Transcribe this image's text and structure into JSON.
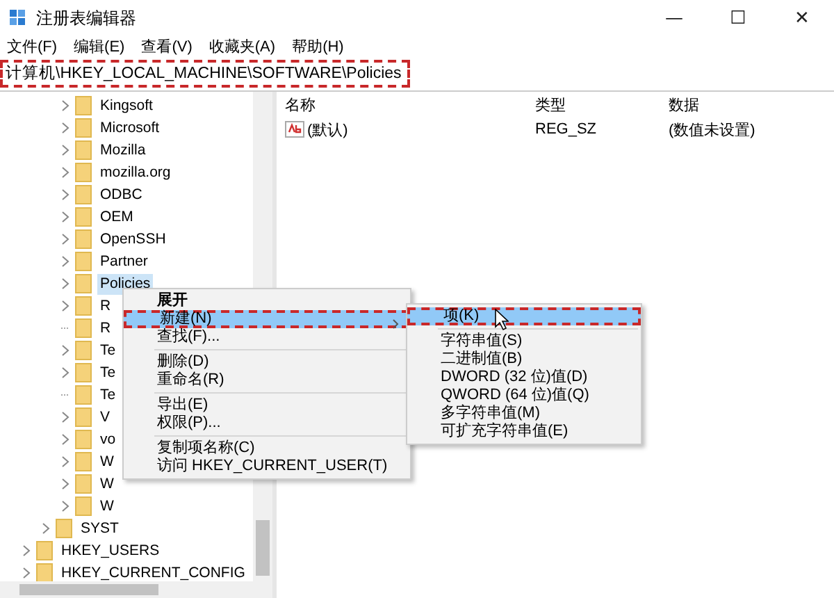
{
  "window": {
    "title": "注册表编辑器",
    "controls": [
      "—",
      "☐",
      "✕"
    ]
  },
  "menu_bar": [
    {
      "label": "文件(F)"
    },
    {
      "label": "编辑(E)"
    },
    {
      "label": "查看(V)"
    },
    {
      "label": "收藏夹(A)"
    },
    {
      "label": "帮助(H)"
    }
  ],
  "address": {
    "value": "计算机\\HKEY_LOCAL_MACHINE\\SOFTWARE\\Policies",
    "outlined": true
  },
  "tree": {
    "items": [
      {
        "children": [
          {
            "children": [
              {
                "label": "Kingsoft",
                "expandable": true,
                "selected": false
              },
              {
                "label": "Microsoft",
                "expandable": true,
                "selected": false
              },
              {
                "label": "Mozilla",
                "expandable": true,
                "selected": false
              },
              {
                "label": "mozilla.org",
                "expandable": true,
                "selected": false
              },
              {
                "label": "ODBC",
                "expandable": true,
                "selected": false
              },
              {
                "label": "OEM",
                "expandable": true,
                "selected": false
              },
              {
                "label": "OpenSSH",
                "expandable": true,
                "selected": false
              },
              {
                "label": "Partner",
                "expandable": true,
                "selected": false
              },
              {
                "label": "Policies",
                "expandable": true,
                "selected": true
              },
              {
                "label": "R",
                "expandable": true,
                "selected": false
              },
              {
                "label": "R",
                "expandable": false,
                "selected": false
              },
              {
                "label": "Te",
                "expandable": true,
                "selected": false
              },
              {
                "label": "Te",
                "expandable": true,
                "selected": false
              },
              {
                "label": "Te",
                "expandable": false,
                "selected": false
              },
              {
                "label": "V",
                "expandable": true,
                "selected": false
              },
              {
                "label": "vo",
                "expandable": true,
                "selected": false
              },
              {
                "label": "W",
                "expandable": true,
                "selected": false
              },
              {
                "label": "W",
                "expandable": true,
                "selected": false
              },
              {
                "label": "W",
                "expandable": true,
                "selected": false
              }
            ]
          },
          {
            "label": "SYST",
            "expandable": true,
            "selected": false
          }
        ]
      },
      {
        "label": "HKEY_USERS",
        "expandable": true,
        "selected": false
      },
      {
        "label": "HKEY_CURRENT_CONFIG",
        "expandable": true,
        "selected": false
      }
    ]
  },
  "values": {
    "columns": [
      "名称",
      "类型",
      "数据"
    ],
    "rows": [
      {
        "name": "(默认)",
        "type": "REG_SZ",
        "data": "(数值未设置)"
      }
    ]
  },
  "context_menu": [
    {
      "kind": "item",
      "label": "展开",
      "default": true,
      "selected": false,
      "outlined": false,
      "submenu": false
    },
    {
      "kind": "item",
      "label": "新建(N)",
      "default": false,
      "selected": true,
      "outlined": true,
      "submenu": true
    },
    {
      "kind": "item",
      "label": "查找(F)...",
      "default": false,
      "selected": false,
      "outlined": false,
      "submenu": false
    },
    {
      "kind": "separator"
    },
    {
      "kind": "item",
      "label": "删除(D)",
      "default": false,
      "selected": false,
      "outlined": false,
      "submenu": false
    },
    {
      "kind": "item",
      "label": "重命名(R)",
      "default": false,
      "selected": false,
      "outlined": false,
      "submenu": false
    },
    {
      "kind": "separator"
    },
    {
      "kind": "item",
      "label": "导出(E)",
      "default": false,
      "selected": false,
      "outlined": false,
      "submenu": false
    },
    {
      "kind": "item",
      "label": "权限(P)...",
      "default": false,
      "selected": false,
      "outlined": false,
      "submenu": false
    },
    {
      "kind": "separator"
    },
    {
      "kind": "item",
      "label": "复制项名称(C)",
      "default": false,
      "selected": false,
      "outlined": false,
      "submenu": false
    },
    {
      "kind": "item",
      "label": "访问 HKEY_CURRENT_USER(T)",
      "default": false,
      "selected": false,
      "outlined": false,
      "submenu": false
    }
  ],
  "submenu": [
    {
      "kind": "item",
      "label": "项(K)",
      "selected": true,
      "outlined": true
    },
    {
      "kind": "separator"
    },
    {
      "kind": "item",
      "label": "字符串值(S)",
      "selected": false,
      "outlined": false
    },
    {
      "kind": "item",
      "label": "二进制值(B)",
      "selected": false,
      "outlined": false
    },
    {
      "kind": "item",
      "label": "DWORD (32 位)值(D)",
      "selected": false,
      "outlined": false
    },
    {
      "kind": "item",
      "label": "QWORD (64 位)值(Q)",
      "selected": false,
      "outlined": false
    },
    {
      "kind": "item",
      "label": "多字符串值(M)",
      "selected": false,
      "outlined": false
    },
    {
      "kind": "item",
      "label": "可扩充字符串值(E)",
      "selected": false,
      "outlined": false
    }
  ]
}
